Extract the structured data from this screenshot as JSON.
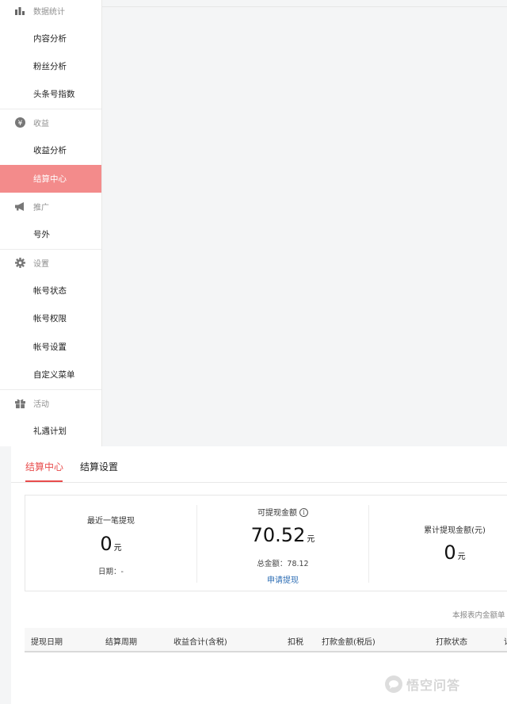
{
  "sidebar": {
    "groups": [
      {
        "label": "数据统计",
        "icon": "bar-chart-icon"
      },
      {
        "label": "收益",
        "icon": "yen-icon"
      },
      {
        "label": "推广",
        "icon": "megaphone-icon"
      },
      {
        "label": "设置",
        "icon": "gear-icon"
      },
      {
        "label": "活动",
        "icon": "gift-icon"
      }
    ],
    "items": [
      "内容分析",
      "粉丝分析",
      "头条号指数",
      "收益分析",
      "结算中心",
      "号外",
      "帐号状态",
      "帐号权限",
      "帐号设置",
      "自定义菜单",
      "礼遇计划"
    ],
    "active_item": "结算中心",
    "active_color": "#f38b8b"
  },
  "tabs": [
    "结算中心",
    "结算设置"
  ],
  "accent_color": "#e84c4c",
  "stats": {
    "recent": {
      "title": "最近一笔提现",
      "value": "0",
      "unit": "元",
      "date_label": "日期：",
      "date_value": "-"
    },
    "available": {
      "title": "可提现金额",
      "value": "70.52",
      "unit": "元",
      "total_label": "总金额：",
      "total_value": "78.12",
      "apply_link": "申请提现"
    },
    "cumulative": {
      "title": "累计提现金额(元)",
      "value": "0",
      "unit": "元"
    }
  },
  "note": "本报表内金额单",
  "table": {
    "headers": [
      "提现日期",
      "结算周期",
      "收益合计(含税)",
      "扣税",
      "打款金额(税后)",
      "打款状态",
      "详"
    ]
  },
  "watermark": "悟空问答"
}
